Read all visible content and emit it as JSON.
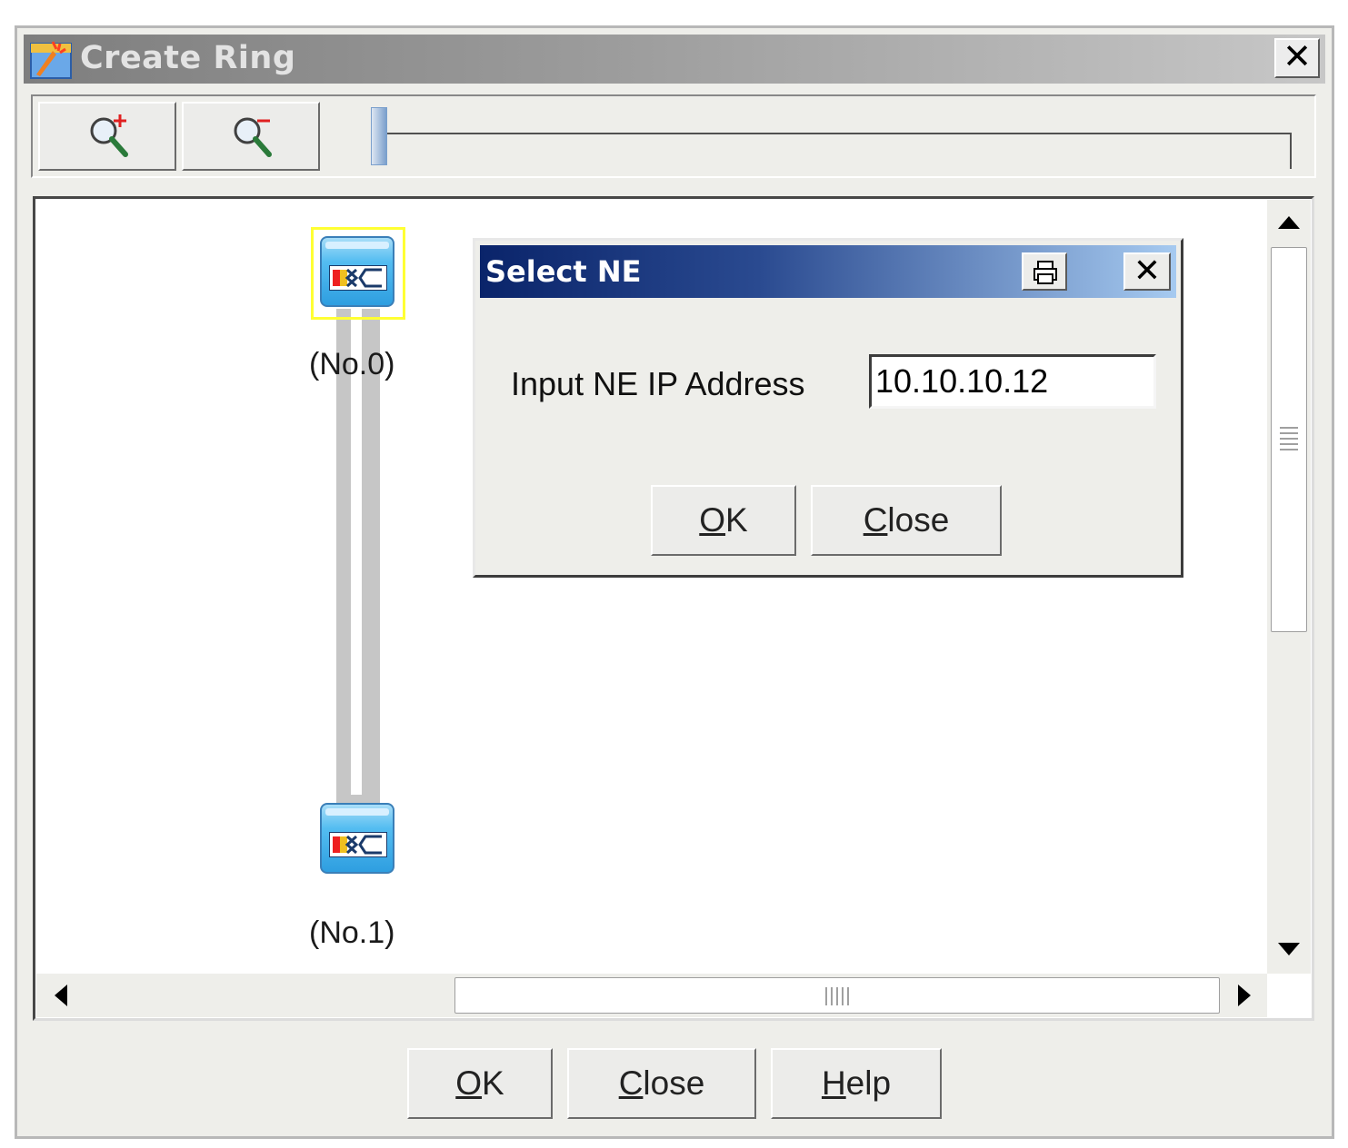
{
  "window": {
    "title": "Create Ring",
    "icon": "app-wizard-icon"
  },
  "toolbar": {
    "zoom_in_icon": "zoom-in-icon",
    "zoom_out_icon": "zoom-out-icon",
    "zoom_slider_value": 0
  },
  "canvas": {
    "nodes": [
      {
        "label": "(No.0)",
        "icon": "network-element-icon",
        "selected": true
      },
      {
        "label": "(No.1)",
        "icon": "network-element-icon",
        "selected": false
      }
    ],
    "link_icon": "ring-link"
  },
  "dialog": {
    "title": "Select NE",
    "ip_label": "Input NE IP Address",
    "ip_value": "10.10.10.12",
    "ok_mnemonic": "O",
    "ok_rest": "K",
    "close_mnemonic": "C",
    "close_rest": "lose"
  },
  "footer": {
    "ok_mnemonic": "O",
    "ok_rest": "K",
    "close_mnemonic": "C",
    "close_rest": "lose",
    "help_mnemonic": "H",
    "help_rest": "elp"
  },
  "colors": {
    "selection": "#ffff33",
    "dialog_title_start": "#0a246a",
    "dialog_title_end": "#a6caf0",
    "ne_icon_blue": "#2e9ee0"
  }
}
